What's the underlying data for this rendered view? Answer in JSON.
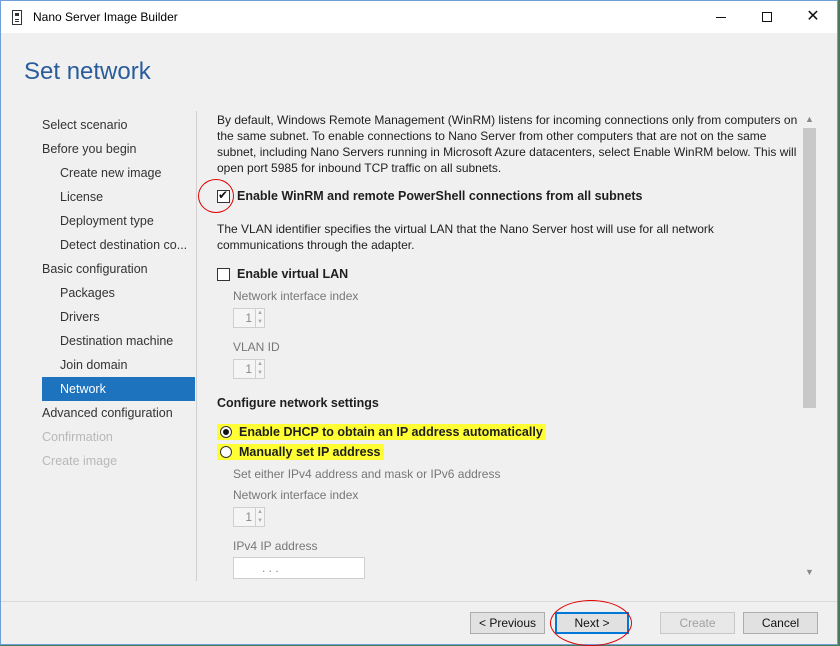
{
  "window": {
    "title": "Nano Server Image Builder",
    "minimize": "—",
    "maximize": "☐",
    "close": "✕"
  },
  "page_title": "Set network",
  "nav": {
    "items": [
      {
        "label": "Select scenario",
        "level": 1,
        "state": "normal"
      },
      {
        "label": "Before you begin",
        "level": 1,
        "state": "normal"
      },
      {
        "label": "Create new image",
        "level": 2,
        "state": "normal"
      },
      {
        "label": "License",
        "level": 2,
        "state": "normal"
      },
      {
        "label": "Deployment type",
        "level": 2,
        "state": "normal"
      },
      {
        "label": "Detect destination co...",
        "level": 2,
        "state": "normal"
      },
      {
        "label": "Basic configuration",
        "level": 1,
        "state": "normal"
      },
      {
        "label": "Packages",
        "level": 2,
        "state": "normal"
      },
      {
        "label": "Drivers",
        "level": 2,
        "state": "normal"
      },
      {
        "label": "Destination machine",
        "level": 2,
        "state": "normal"
      },
      {
        "label": "Join domain",
        "level": 2,
        "state": "normal"
      },
      {
        "label": "Network",
        "level": 2,
        "state": "selected"
      },
      {
        "label": "Advanced configuration",
        "level": 1,
        "state": "normal"
      },
      {
        "label": "Confirmation",
        "level": 1,
        "state": "disabled"
      },
      {
        "label": "Create image",
        "level": 1,
        "state": "disabled"
      }
    ]
  },
  "content": {
    "winrm_description": "By default, Windows Remote Management (WinRM) listens for incoming connections only from computers on the same subnet. To enable connections to Nano Server from other computers that are not on the same subnet, including Nano Servers running in Microsoft Azure datacenters, select Enable WinRM below. This will open port 5985 for inbound TCP traffic on all subnets.",
    "enable_winrm_label": "Enable WinRM and remote PowerShell connections from all subnets",
    "enable_winrm_checked": true,
    "vlan_description": "The VLAN identifier specifies the virtual LAN that the Nano Server host will use for all network communications through the adapter.",
    "enable_vlan_label": "Enable virtual LAN",
    "enable_vlan_checked": false,
    "vlan_nic_index_label": "Network interface index",
    "vlan_nic_index_value": "1",
    "vlan_id_label": "VLAN ID",
    "vlan_id_value": "1",
    "configure_network_title": "Configure network settings",
    "dhcp_label": "Enable DHCP to obtain an IP address automatically",
    "dhcp_selected": true,
    "manual_ip_label": "Manually set IP address",
    "manual_ip_selected": false,
    "manual_hint": "Set either IPv4 address and mask or IPv6 address",
    "manual_nic_index_label": "Network interface index",
    "manual_nic_index_value": "1",
    "ipv4_label": "IPv4 IP address",
    "ipv4_value": ".   .   ."
  },
  "buttons": {
    "previous": "< Previous",
    "next": "Next >",
    "create": "Create",
    "cancel": "Cancel"
  },
  "colors": {
    "selected_nav": "#1e73be",
    "title_blue": "#2a5c9a",
    "highlight_yellow": "#ffff33",
    "annotation_red": "#e00000"
  }
}
